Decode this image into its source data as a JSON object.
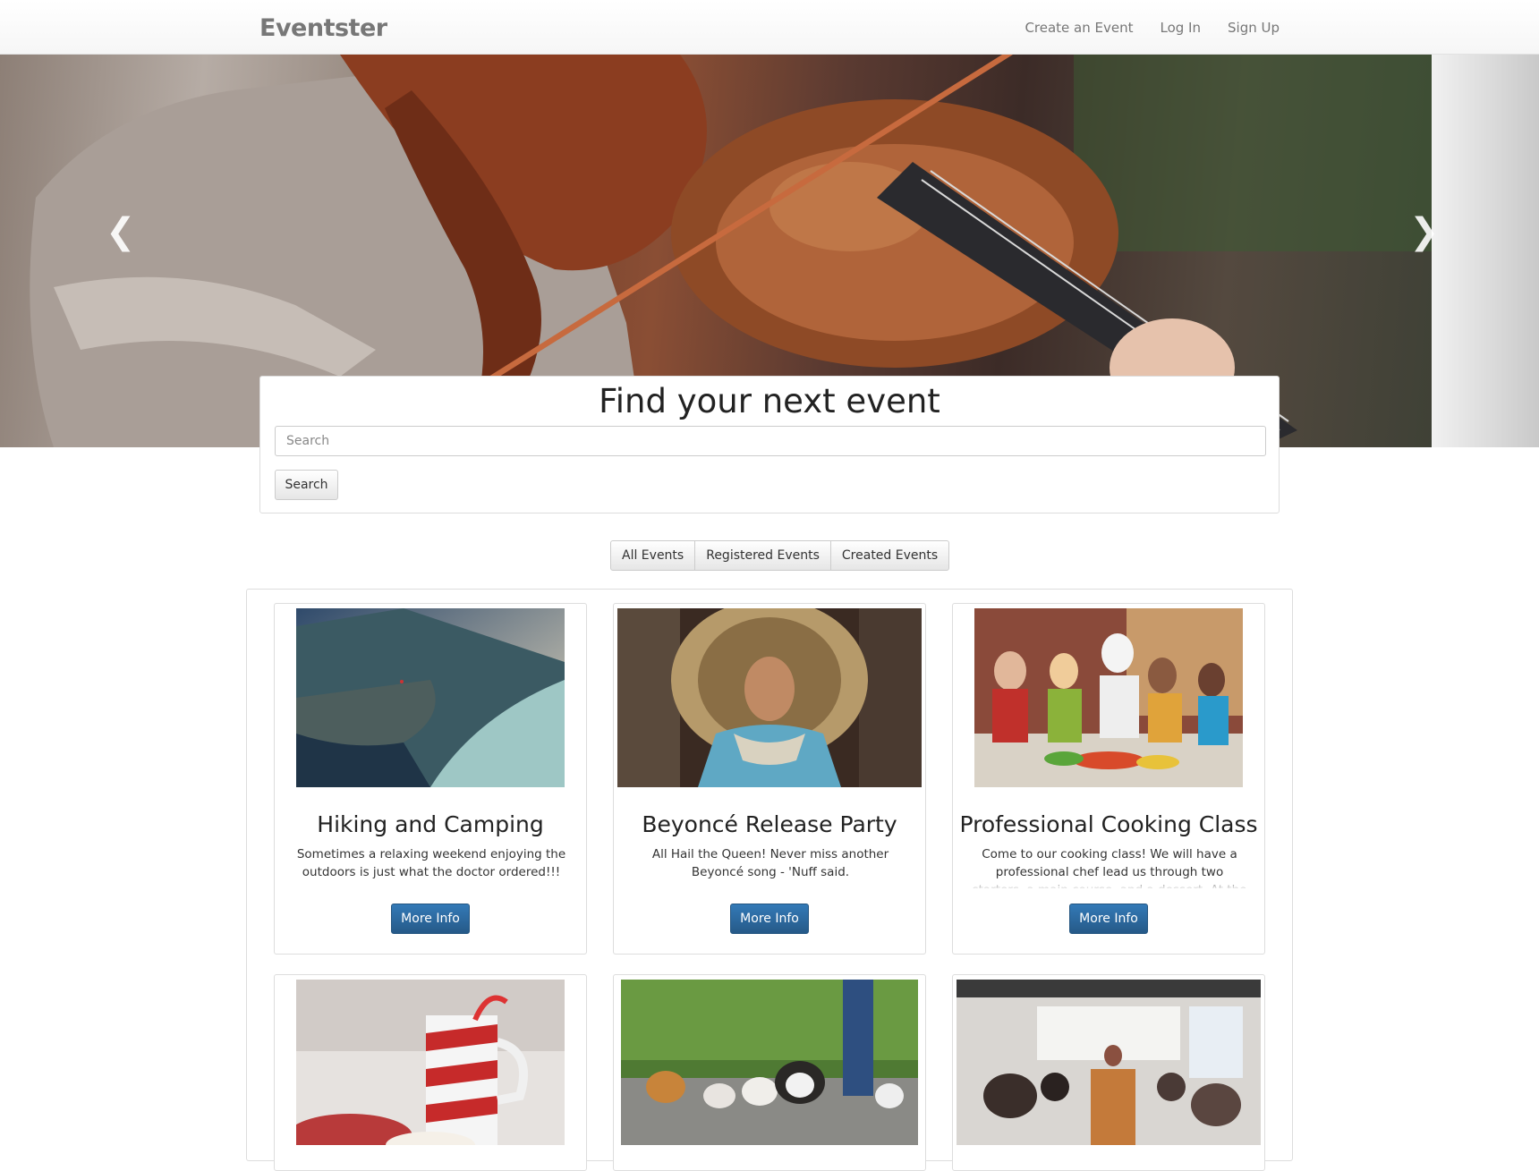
{
  "navbar": {
    "brand": "Eventster",
    "links": [
      "Create an Event",
      "Log In",
      "Sign Up"
    ]
  },
  "hero": {
    "prev_icon": "chevron-left-icon",
    "next_icon": "chevron-right-icon",
    "prev_glyph": "❮",
    "next_glyph": "❯"
  },
  "search": {
    "title": "Find your next event",
    "placeholder": "Search",
    "button_label": "Search"
  },
  "filters": [
    "All Events",
    "Registered Events",
    "Created Events"
  ],
  "events": [
    {
      "title": "Hiking and Camping",
      "description": "Sometimes a relaxing weekend enjoying the outdoors is just what the doctor ordered!!!",
      "button_label": "More Info"
    },
    {
      "title": "Beyoncé Release Party",
      "description": "All Hail the Queen! Never miss another Beyoncé song - 'Nuff said.",
      "button_label": "More Info"
    },
    {
      "title": "Professional Cooking Class",
      "description": "Come to our cooking class! We will have a professional chef lead us through two starters, a main course, and a dessert. At the end, we will",
      "button_label": "More Info"
    }
  ],
  "colors": {
    "primary_button": "#337ab7",
    "brand_text": "#777777"
  }
}
